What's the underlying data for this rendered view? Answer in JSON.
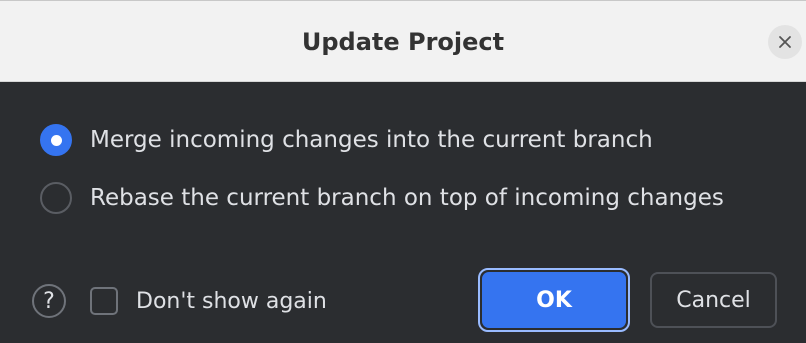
{
  "dialog": {
    "title": "Update Project",
    "close_icon": "close-icon"
  },
  "options": [
    {
      "label": "Merge incoming changes into the current branch",
      "selected": true
    },
    {
      "label": "Rebase the current branch on top of incoming changes",
      "selected": false
    }
  ],
  "footer": {
    "help_label": "?",
    "dont_show_again_label": "Don't show again",
    "dont_show_again_checked": false,
    "ok_label": "OK",
    "cancel_label": "Cancel"
  },
  "colors": {
    "accent": "#3574f0",
    "focus_ring": "#99bbff",
    "body_bg": "#2b2d30",
    "titlebar_bg": "#f2f2f2",
    "text": "#dfe1e5"
  }
}
